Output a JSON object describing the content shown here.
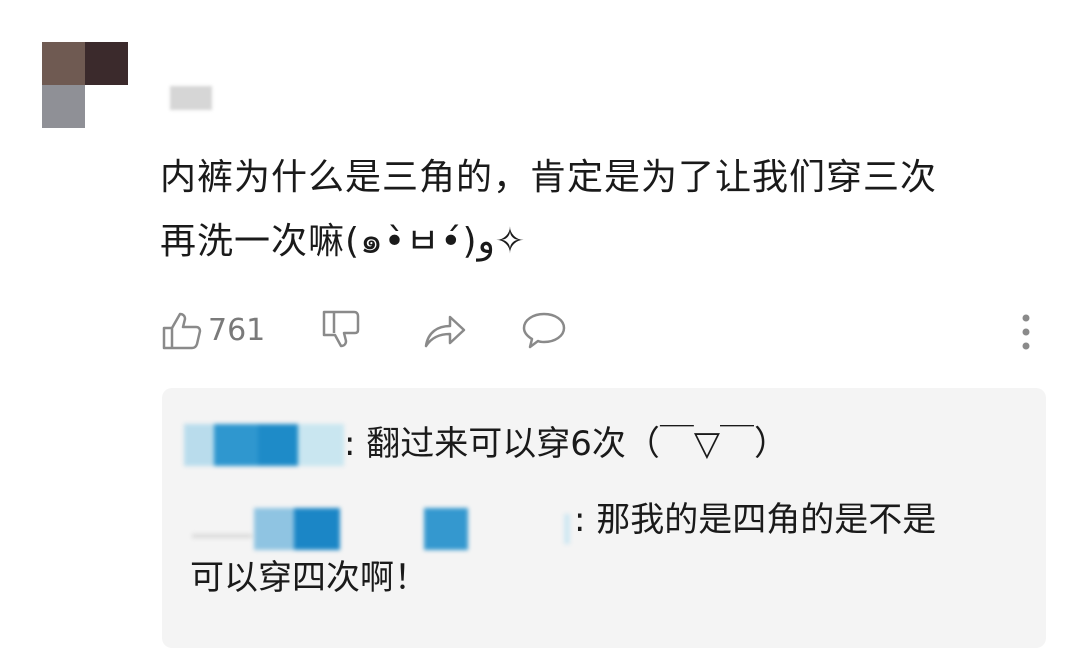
{
  "comment": {
    "text_line1": "内裤为什么是三角的，肯定是为了让我们穿三次",
    "text_line2": "再洗一次嘛(๑•̀ㅂ•́)و✧",
    "like_count": "761"
  },
  "replies": [
    {
      "text": ": 翻过来可以穿6次（￣▽￣）"
    },
    {
      "text_line1": ": 那我的是四角的是不是",
      "text_line2": "可以穿四次啊！"
    }
  ],
  "icons": [
    "thumbs-up-icon",
    "thumbs-down-icon",
    "share-icon",
    "comment-icon",
    "more-icon"
  ]
}
